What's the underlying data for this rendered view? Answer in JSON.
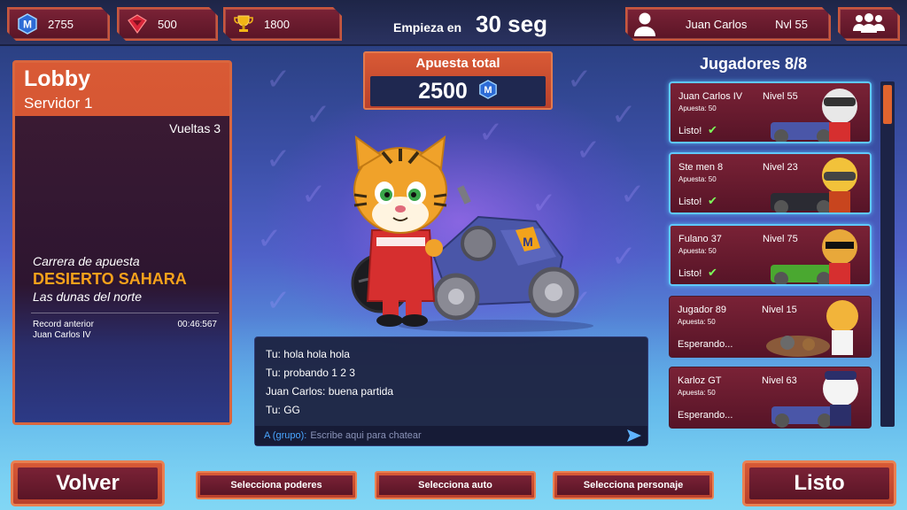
{
  "resources": [
    {
      "icon": "m-coin-icon",
      "value": "2755"
    },
    {
      "icon": "red-gem-icon",
      "value": "500"
    },
    {
      "icon": "trophy-icon",
      "value": "1800"
    }
  ],
  "countdown": {
    "label": "Empieza en",
    "value": "30 seg"
  },
  "profile": {
    "name": "Juan Carlos",
    "level": "Nvl 55"
  },
  "lobby": {
    "title": "Lobby",
    "server": "Servidor 1",
    "laps": "Vueltas 3",
    "mode": "Carrera de apuesta",
    "track": "DESIERTO SAHARA",
    "track_subtitle": "Las dunas del norte",
    "record_label": "Record anterior",
    "record_holder": "Juan Carlos IV",
    "record_time": "00:46:567"
  },
  "bet": {
    "label": "Apuesta total",
    "value": "2500"
  },
  "chat": {
    "messages": [
      "Tu: hola hola hola",
      "Tu: probando 1 2 3",
      "Juan Carlos: buena partida",
      "Tu: GG"
    ],
    "prefix": "A (grupo):",
    "placeholder": "Escribe aqui para chatear"
  },
  "players_title": "Jugadores 8/8",
  "players": [
    {
      "name": "Juan Carlos IV",
      "level": "Nivel 55",
      "bet": "Apuesta: 50",
      "status": "Listo!",
      "ready": true
    },
    {
      "name": "Ste men 8",
      "level": "Nivel 23",
      "bet": "Apuesta: 50",
      "status": "Listo!",
      "ready": true
    },
    {
      "name": "Fulano 37",
      "level": "Nivel 75",
      "bet": "Apuesta: 50",
      "status": "Listo!",
      "ready": true
    },
    {
      "name": "Jugador 89",
      "level": "Nivel 15",
      "bet": "Apuesta: 50",
      "status": "Esperando...",
      "ready": false
    },
    {
      "name": "Karloz GT",
      "level": "Nivel 63",
      "bet": "Apuesta: 50",
      "status": "Esperando...",
      "ready": false
    }
  ],
  "buttons": {
    "back": "Volver",
    "powers": "Selecciona poderes",
    "car": "Selecciona auto",
    "character": "Selecciona personaje",
    "ready": "Listo"
  },
  "colors": {
    "accent_orange": "#d85a36",
    "panel_red": "#7a2236",
    "track_name": "#f7a21b",
    "ready_check": "#7dff5a",
    "ready_glow": "#5fc8ff"
  }
}
